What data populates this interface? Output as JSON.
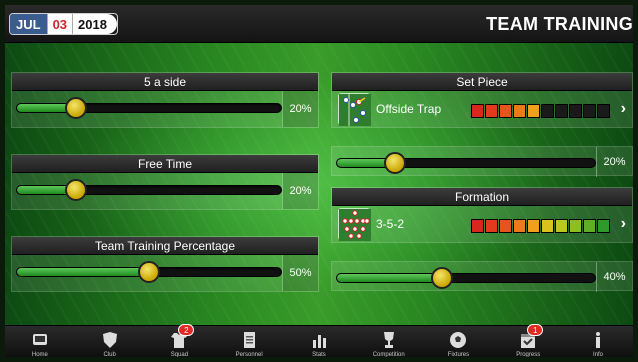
{
  "header": {
    "date": {
      "month": "JUL",
      "day": "03",
      "year": "2018"
    },
    "title": "TEAM TRAINING"
  },
  "left": {
    "five_a_side": {
      "label": "5 a side",
      "value": 20,
      "pct": "20%"
    },
    "free_time": {
      "label": "Free Time",
      "value": 20,
      "pct": "20%"
    },
    "team_training": {
      "label": "Team Training Percentage",
      "value": 50,
      "pct": "50%"
    }
  },
  "right": {
    "set_piece": {
      "label": "Set Piece",
      "name": "Offside Trap",
      "rating_filled": 5,
      "rating_total": 10,
      "slider_value": 20,
      "pct": "20%"
    },
    "formation": {
      "label": "Formation",
      "name": "3-5-2",
      "rating_filled": 10,
      "rating_total": 10,
      "slider_value": 40,
      "pct": "40%"
    }
  },
  "nav": [
    {
      "id": "home",
      "label": "Home",
      "icon": "home-icon"
    },
    {
      "id": "club",
      "label": "Club",
      "icon": "shield-icon"
    },
    {
      "id": "squad",
      "label": "Squad",
      "icon": "shirt-icon",
      "badge": "2"
    },
    {
      "id": "personnel",
      "label": "Personnel",
      "icon": "document-icon"
    },
    {
      "id": "stats",
      "label": "Stats",
      "icon": "bar-chart-icon"
    },
    {
      "id": "competition",
      "label": "Competition",
      "icon": "trophy-icon"
    },
    {
      "id": "fixtures",
      "label": "Fixtures",
      "icon": "football-icon"
    },
    {
      "id": "progress",
      "label": "Progress",
      "icon": "calendar-icon",
      "badge": "1"
    },
    {
      "id": "info",
      "label": "Info",
      "icon": "info-icon"
    }
  ],
  "colors": {
    "accent_green": "#2a8a22",
    "knob_yellow": "#e2c92a",
    "badge_red": "#e02a24",
    "rating": [
      "#d9261e",
      "#e23a1e",
      "#e6531c",
      "#ec7a1a",
      "#f0a01a",
      "#d9c21c",
      "#b9c81e",
      "#8cbf22",
      "#5fae26",
      "#2e9a2a"
    ]
  }
}
